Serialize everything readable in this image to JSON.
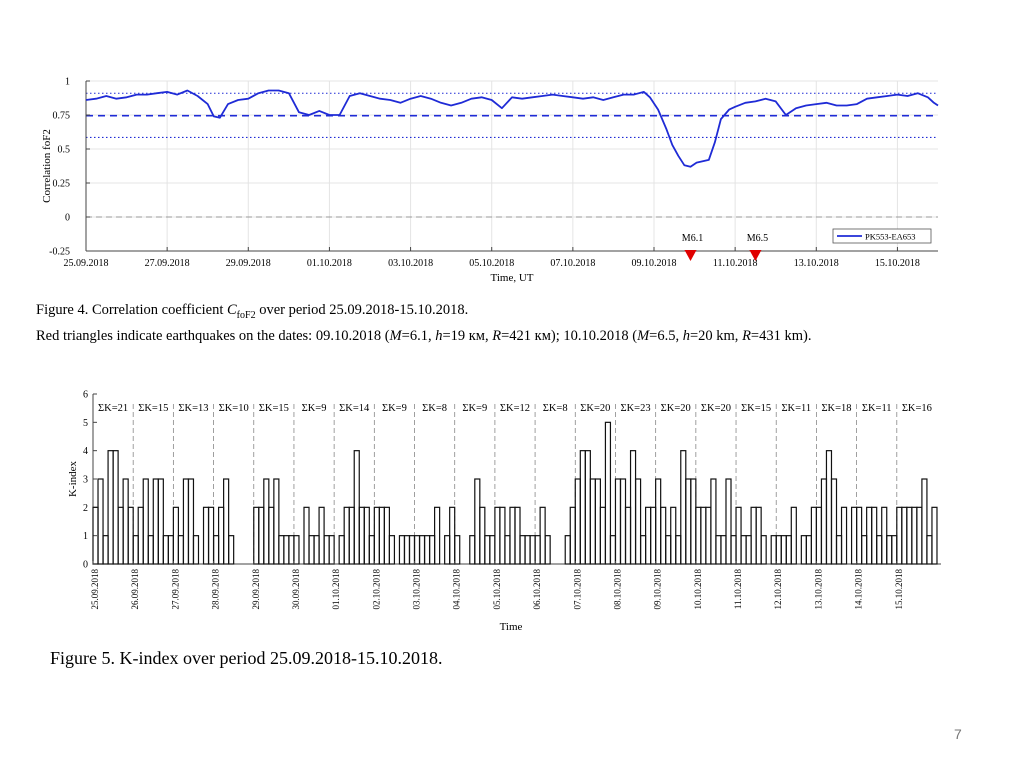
{
  "chart_data": [
    {
      "type": "line",
      "title": "",
      "xlabel": "Time, UT",
      "ylabel": "Correlation foF2",
      "xlim": [
        0,
        21
      ],
      "ylim": [
        -0.25,
        1
      ],
      "yticks": [
        -0.25,
        0,
        0.25,
        0.5,
        0.75,
        1
      ],
      "ytick_labels": [
        "-0.25",
        "0",
        "0.25",
        "0.5",
        "0.75",
        "1"
      ],
      "xticks": [
        0,
        2,
        4,
        6,
        8,
        10,
        12,
        14,
        16,
        18,
        20
      ],
      "xtick_labels": [
        "25.09.2018",
        "27.09.2018",
        "29.09.2018",
        "01.10.2018",
        "03.10.2018",
        "05.10.2018",
        "07.10.2018",
        "09.10.2018",
        "11.10.2018",
        "13.10.2018",
        "15.10.2018"
      ],
      "grid": true,
      "legend_position": "bottom-right",
      "series": [
        {
          "name": "PK553-EA653",
          "color": "#1f2bd6",
          "x": [
            0,
            0.25,
            0.5,
            0.75,
            1,
            1.25,
            1.5,
            1.75,
            2,
            2.25,
            2.5,
            2.75,
            3,
            3.15,
            3.3,
            3.5,
            3.75,
            4,
            4.25,
            4.5,
            4.75,
            5,
            5.25,
            5.5,
            5.75,
            6,
            6.25,
            6.5,
            6.75,
            7,
            7.25,
            7.5,
            7.75,
            8,
            8.25,
            8.5,
            8.75,
            9,
            9.25,
            9.5,
            9.75,
            10,
            10.25,
            10.5,
            10.75,
            11,
            11.25,
            11.5,
            11.75,
            12,
            12.25,
            12.5,
            12.75,
            13,
            13.25,
            13.5,
            13.75,
            13.9,
            14.1,
            14.3,
            14.45,
            14.6,
            14.75,
            14.9,
            15.05,
            15.2,
            15.35,
            15.5,
            15.65,
            15.85,
            16,
            16.25,
            16.5,
            16.75,
            17,
            17.25,
            17.5,
            17.75,
            18,
            18.25,
            18.5,
            18.75,
            19,
            19.25,
            19.5,
            19.75,
            20,
            20.25,
            20.5,
            20.75,
            20.9,
            21
          ],
          "y": [
            0.86,
            0.87,
            0.89,
            0.87,
            0.88,
            0.9,
            0.9,
            0.91,
            0.92,
            0.9,
            0.93,
            0.89,
            0.83,
            0.74,
            0.73,
            0.83,
            0.86,
            0.87,
            0.91,
            0.93,
            0.93,
            0.91,
            0.77,
            0.75,
            0.78,
            0.75,
            0.75,
            0.89,
            0.91,
            0.89,
            0.87,
            0.86,
            0.84,
            0.87,
            0.89,
            0.87,
            0.84,
            0.82,
            0.84,
            0.87,
            0.88,
            0.86,
            0.8,
            0.88,
            0.87,
            0.88,
            0.89,
            0.9,
            0.89,
            0.88,
            0.87,
            0.88,
            0.86,
            0.88,
            0.9,
            0.9,
            0.92,
            0.88,
            0.79,
            0.65,
            0.53,
            0.45,
            0.38,
            0.37,
            0.4,
            0.41,
            0.42,
            0.55,
            0.72,
            0.79,
            0.81,
            0.84,
            0.85,
            0.87,
            0.85,
            0.75,
            0.8,
            0.82,
            0.83,
            0.84,
            0.82,
            0.82,
            0.83,
            0.87,
            0.88,
            0.89,
            0.9,
            0.89,
            0.91,
            0.88,
            0.84,
            0.82
          ]
        }
      ],
      "reference_lines": [
        {
          "style": "dashed",
          "color": "#1f2bd6",
          "y": 0.745
        },
        {
          "style": "dotted",
          "color": "#1f2bd6",
          "y": 0.91
        },
        {
          "style": "dotted",
          "color": "#1f2bd6",
          "y": 0.585
        },
        {
          "style": "dashed",
          "color": "#999999",
          "y": 0
        }
      ],
      "annotations": [
        {
          "text": "M6.1",
          "x": 14.9,
          "color": "#e00000"
        },
        {
          "text": "M6.5",
          "x": 16.5,
          "color": "#e00000"
        }
      ]
    },
    {
      "type": "bar",
      "title": "",
      "xlabel": "Time",
      "ylabel": "K-index",
      "ylim": [
        0,
        6
      ],
      "yticks": [
        0,
        1,
        2,
        3,
        4,
        5,
        6
      ],
      "grid": false,
      "days": [
        "25.09.2018",
        "26.09.2018",
        "27.09.2018",
        "28.09.2018",
        "29.09.2018",
        "30.09.2018",
        "01.10.2018",
        "02.10.2018",
        "03.10.2018",
        "04.10.2018",
        "05.10.2018",
        "06.10.2018",
        "07.10.2018",
        "08.10.2018",
        "09.10.2018",
        "10.10.2018",
        "11.10.2018",
        "12.10.2018",
        "13.10.2018",
        "14.10.2018",
        "15.10.2018"
      ],
      "sum_labels": [
        "ΣK=21",
        "ΣK=15",
        "ΣK=13",
        "ΣK=10",
        "ΣK=15",
        "ΣK=9",
        "ΣK=14",
        "ΣK=9",
        "ΣK=8",
        "ΣK=9",
        "ΣK=12",
        "ΣK=8",
        "ΣK=20",
        "ΣK=23",
        "ΣK=20",
        "ΣK=20",
        "ΣK=15",
        "ΣK=11",
        "ΣK=18",
        "ΣK=11",
        "ΣK=16"
      ],
      "values": [
        [
          2,
          3,
          1,
          4,
          4,
          2,
          3,
          2
        ],
        [
          1,
          2,
          3,
          1,
          3,
          3,
          1,
          1
        ],
        [
          2,
          1,
          3,
          3,
          1,
          0,
          2,
          2
        ],
        [
          1,
          2,
          3,
          1,
          0,
          0,
          0,
          0
        ],
        [
          2,
          2,
          3,
          2,
          3,
          1,
          1,
          1
        ],
        [
          1,
          0,
          2,
          1,
          1,
          2,
          1,
          1
        ],
        [
          0,
          1,
          2,
          2,
          4,
          2,
          2,
          1
        ],
        [
          2,
          2,
          2,
          1,
          0,
          1,
          1,
          1
        ],
        [
          1,
          1,
          1,
          1,
          2,
          0,
          1,
          2
        ],
        [
          1,
          0,
          0,
          1,
          3,
          2,
          1,
          1
        ],
        [
          2,
          2,
          1,
          2,
          2,
          1,
          1,
          1
        ],
        [
          1,
          2,
          1,
          0,
          0,
          0,
          1,
          2
        ],
        [
          3,
          4,
          4,
          3,
          3,
          2,
          5,
          1
        ],
        [
          3,
          3,
          2,
          4,
          3,
          1,
          2,
          2
        ],
        [
          3,
          2,
          1,
          2,
          1,
          4,
          3,
          3
        ],
        [
          2,
          2,
          2,
          3,
          1,
          1,
          3,
          1
        ],
        [
          2,
          1,
          1,
          2,
          2,
          1,
          0,
          1
        ],
        [
          1,
          1,
          1,
          2,
          0,
          1,
          1,
          2
        ],
        [
          2,
          3,
          4,
          3,
          1,
          2,
          0,
          2
        ],
        [
          2,
          1,
          2,
          2,
          1,
          2,
          1,
          1
        ],
        [
          2,
          2,
          2,
          2,
          2,
          3,
          1,
          2
        ]
      ]
    }
  ],
  "captions": {
    "fig4_line1_prefix": "Figure 4. Correlation coefficient ",
    "fig4_line1_var": "C",
    "fig4_line1_sub": "foF2",
    "fig4_line1_suffix": " over period 25.09.2018-15.10.2018.",
    "fig4_line2_a": "Red triangles indicate earthquakes on the dates: 09.10.2018  (",
    "fig4_line2_b": "=6.1, ",
    "fig4_line2_c": "=19 км, ",
    "fig4_line2_d": "=421 км);   10.10.2018 (",
    "fig4_line2_e": "=6.5, ",
    "fig4_line2_f": "=20 km, ",
    "fig4_line2_g": "=431 km).",
    "var_m": "M",
    "var_h": "h",
    "var_r": "R",
    "fig5": "Figure 5. K-index over period 25.09.2018-15.10.2018."
  },
  "page_number": "7"
}
